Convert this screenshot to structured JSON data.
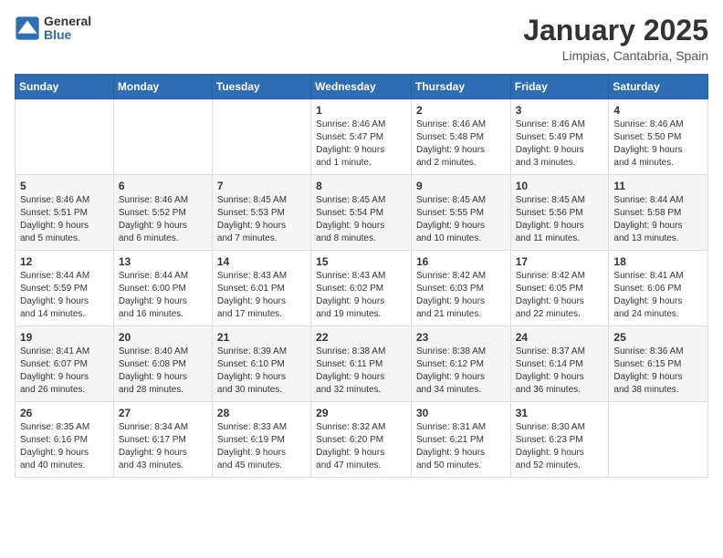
{
  "logo": {
    "text_general": "General",
    "text_blue": "Blue"
  },
  "header": {
    "month": "January 2025",
    "location": "Limpias, Cantabria, Spain"
  },
  "weekdays": [
    "Sunday",
    "Monday",
    "Tuesday",
    "Wednesday",
    "Thursday",
    "Friday",
    "Saturday"
  ],
  "weeks": [
    [
      {
        "day": "",
        "info": ""
      },
      {
        "day": "",
        "info": ""
      },
      {
        "day": "",
        "info": ""
      },
      {
        "day": "1",
        "info": "Sunrise: 8:46 AM\nSunset: 5:47 PM\nDaylight: 9 hours\nand 1 minute."
      },
      {
        "day": "2",
        "info": "Sunrise: 8:46 AM\nSunset: 5:48 PM\nDaylight: 9 hours\nand 2 minutes."
      },
      {
        "day": "3",
        "info": "Sunrise: 8:46 AM\nSunset: 5:49 PM\nDaylight: 9 hours\nand 3 minutes."
      },
      {
        "day": "4",
        "info": "Sunrise: 8:46 AM\nSunset: 5:50 PM\nDaylight: 9 hours\nand 4 minutes."
      }
    ],
    [
      {
        "day": "5",
        "info": "Sunrise: 8:46 AM\nSunset: 5:51 PM\nDaylight: 9 hours\nand 5 minutes."
      },
      {
        "day": "6",
        "info": "Sunrise: 8:46 AM\nSunset: 5:52 PM\nDaylight: 9 hours\nand 6 minutes."
      },
      {
        "day": "7",
        "info": "Sunrise: 8:45 AM\nSunset: 5:53 PM\nDaylight: 9 hours\nand 7 minutes."
      },
      {
        "day": "8",
        "info": "Sunrise: 8:45 AM\nSunset: 5:54 PM\nDaylight: 9 hours\nand 8 minutes."
      },
      {
        "day": "9",
        "info": "Sunrise: 8:45 AM\nSunset: 5:55 PM\nDaylight: 9 hours\nand 10 minutes."
      },
      {
        "day": "10",
        "info": "Sunrise: 8:45 AM\nSunset: 5:56 PM\nDaylight: 9 hours\nand 11 minutes."
      },
      {
        "day": "11",
        "info": "Sunrise: 8:44 AM\nSunset: 5:58 PM\nDaylight: 9 hours\nand 13 minutes."
      }
    ],
    [
      {
        "day": "12",
        "info": "Sunrise: 8:44 AM\nSunset: 5:59 PM\nDaylight: 9 hours\nand 14 minutes."
      },
      {
        "day": "13",
        "info": "Sunrise: 8:44 AM\nSunset: 6:00 PM\nDaylight: 9 hours\nand 16 minutes."
      },
      {
        "day": "14",
        "info": "Sunrise: 8:43 AM\nSunset: 6:01 PM\nDaylight: 9 hours\nand 17 minutes."
      },
      {
        "day": "15",
        "info": "Sunrise: 8:43 AM\nSunset: 6:02 PM\nDaylight: 9 hours\nand 19 minutes."
      },
      {
        "day": "16",
        "info": "Sunrise: 8:42 AM\nSunset: 6:03 PM\nDaylight: 9 hours\nand 21 minutes."
      },
      {
        "day": "17",
        "info": "Sunrise: 8:42 AM\nSunset: 6:05 PM\nDaylight: 9 hours\nand 22 minutes."
      },
      {
        "day": "18",
        "info": "Sunrise: 8:41 AM\nSunset: 6:06 PM\nDaylight: 9 hours\nand 24 minutes."
      }
    ],
    [
      {
        "day": "19",
        "info": "Sunrise: 8:41 AM\nSunset: 6:07 PM\nDaylight: 9 hours\nand 26 minutes."
      },
      {
        "day": "20",
        "info": "Sunrise: 8:40 AM\nSunset: 6:08 PM\nDaylight: 9 hours\nand 28 minutes."
      },
      {
        "day": "21",
        "info": "Sunrise: 8:39 AM\nSunset: 6:10 PM\nDaylight: 9 hours\nand 30 minutes."
      },
      {
        "day": "22",
        "info": "Sunrise: 8:38 AM\nSunset: 6:11 PM\nDaylight: 9 hours\nand 32 minutes."
      },
      {
        "day": "23",
        "info": "Sunrise: 8:38 AM\nSunset: 6:12 PM\nDaylight: 9 hours\nand 34 minutes."
      },
      {
        "day": "24",
        "info": "Sunrise: 8:37 AM\nSunset: 6:14 PM\nDaylight: 9 hours\nand 36 minutes."
      },
      {
        "day": "25",
        "info": "Sunrise: 8:36 AM\nSunset: 6:15 PM\nDaylight: 9 hours\nand 38 minutes."
      }
    ],
    [
      {
        "day": "26",
        "info": "Sunrise: 8:35 AM\nSunset: 6:16 PM\nDaylight: 9 hours\nand 40 minutes."
      },
      {
        "day": "27",
        "info": "Sunrise: 8:34 AM\nSunset: 6:17 PM\nDaylight: 9 hours\nand 43 minutes."
      },
      {
        "day": "28",
        "info": "Sunrise: 8:33 AM\nSunset: 6:19 PM\nDaylight: 9 hours\nand 45 minutes."
      },
      {
        "day": "29",
        "info": "Sunrise: 8:32 AM\nSunset: 6:20 PM\nDaylight: 9 hours\nand 47 minutes."
      },
      {
        "day": "30",
        "info": "Sunrise: 8:31 AM\nSunset: 6:21 PM\nDaylight: 9 hours\nand 50 minutes."
      },
      {
        "day": "31",
        "info": "Sunrise: 8:30 AM\nSunset: 6:23 PM\nDaylight: 9 hours\nand 52 minutes."
      },
      {
        "day": "",
        "info": ""
      }
    ]
  ]
}
